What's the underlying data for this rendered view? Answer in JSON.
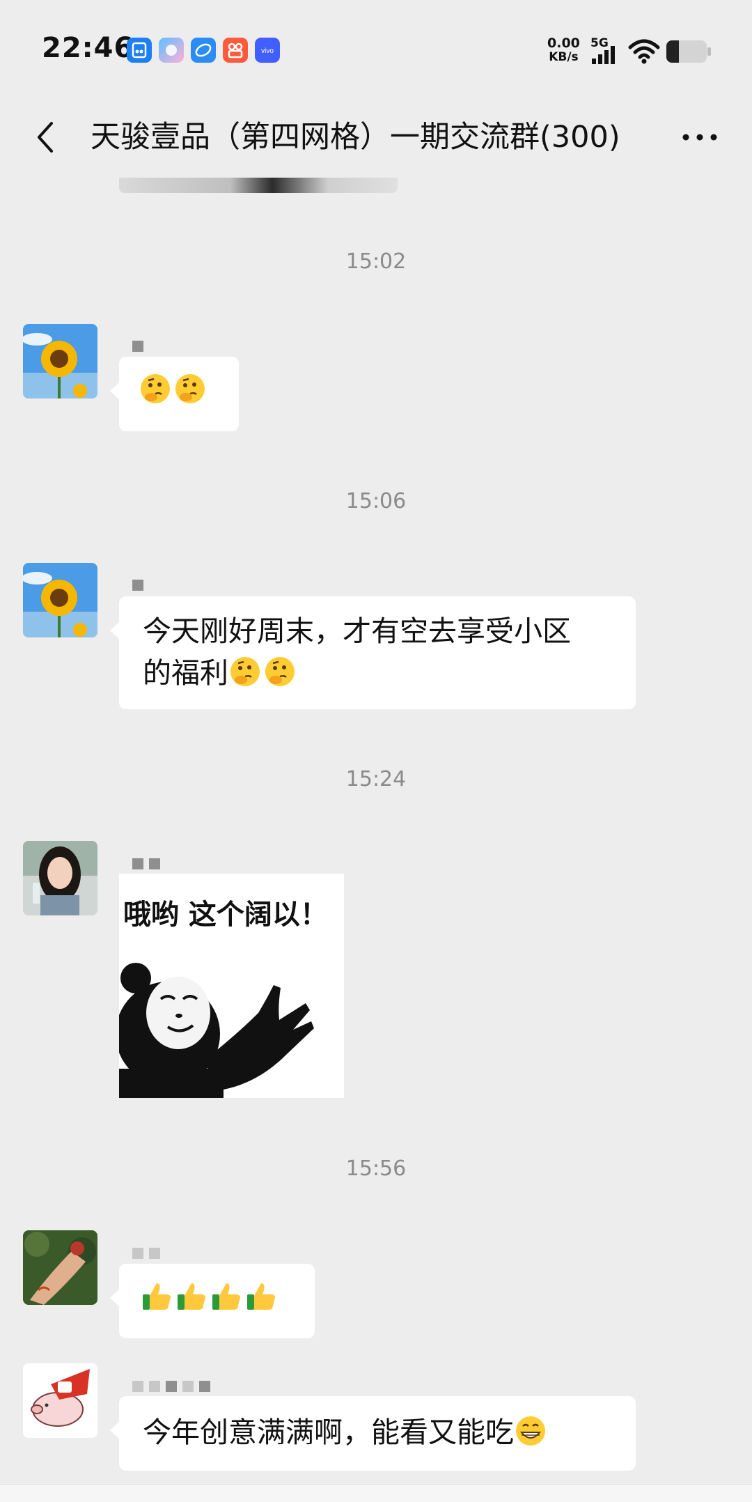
{
  "status_bar": {
    "time": "22:46",
    "network_speed_value": "0.00",
    "network_speed_unit": "KB/s",
    "network_type": "5G",
    "app_icons": [
      "clipboard-app-icon",
      "assistant-app-icon",
      "browser-app-icon",
      "kuaishou-app-icon",
      "vivo-app-icon"
    ],
    "vivo_label": "vivo"
  },
  "nav": {
    "title": "天骏壹品（第四网格）一期交流群(300)"
  },
  "messages": {
    "ts1": "15:02",
    "ts2": "15:06",
    "ts3": "15:24",
    "ts4": "15:56",
    "m1": {
      "emoji": [
        "thinking-face-emoji",
        "thinking-face-emoji"
      ]
    },
    "m2": {
      "line1": "今天刚好周末，才有空去享受小区",
      "line2": "的福利"
    },
    "m3": {
      "sticker_caption": "哦哟 这个阔以！"
    },
    "m4": {
      "emoji": [
        "thumbs-up-emoji",
        "thumbs-up-emoji",
        "thumbs-up-emoji",
        "thumbs-up-emoji"
      ]
    },
    "m5": {
      "text": "今年创意满满啊，能看又能吃"
    }
  },
  "colors": {
    "background": "#ededed",
    "bubble": "#ffffff",
    "timestamp": "#8a8a8a"
  }
}
